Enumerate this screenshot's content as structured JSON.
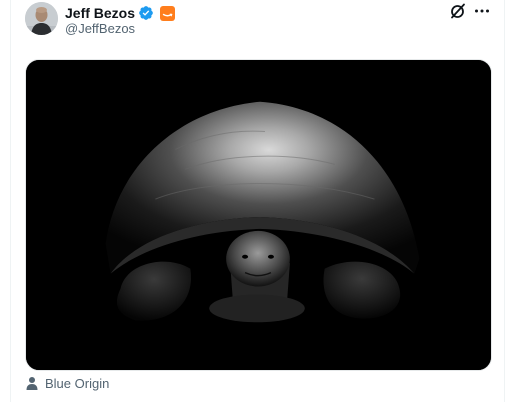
{
  "author": {
    "display_name": "Jeff Bezos",
    "handle": "@JeffBezos",
    "verified": true,
    "affiliate_badge": "amazon-logo-icon"
  },
  "header_actions": {
    "grok_icon": "grok-icon",
    "more_icon": "more-horizontal-icon"
  },
  "media": {
    "type": "photo",
    "subject": "tortoise-in-dark"
  },
  "tagged": {
    "icon": "person-icon",
    "label": "Blue Origin"
  },
  "colors": {
    "verified_blue": "#1d9bf0",
    "affiliate_orange": "#ff7e1d",
    "secondary_text": "#536471",
    "primary_text": "#0f1419"
  }
}
